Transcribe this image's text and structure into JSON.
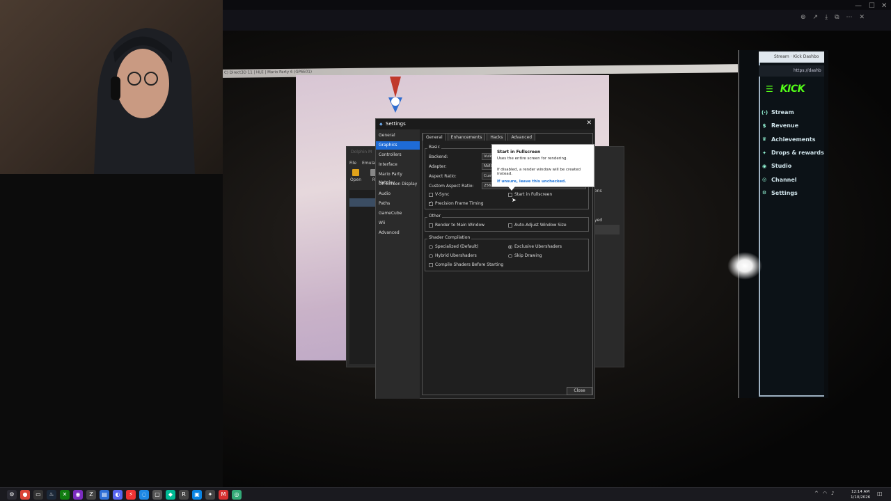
{
  "settings_window": {
    "title": "Settings",
    "sidebar": [
      "General",
      "Graphics",
      "Controllers",
      "Interface",
      "Mario Party Netplay",
      "On-Screen Display",
      "Audio",
      "Paths",
      "GameCube",
      "Wii",
      "Advanced"
    ],
    "active_sidebar": "Graphics",
    "tabs": [
      "General",
      "Enhancements",
      "Hacks",
      "Advanced"
    ],
    "active_tab": "General",
    "basic": {
      "group_label": "Basic",
      "backend_label": "Backend:",
      "backend_value": "Vulk",
      "adapter_label": "Adapter:",
      "adapter_value": "NVID",
      "aspect_label": "Aspect Ratio:",
      "aspect_value": "Cust",
      "custom_aspect_label": "Custom Aspect Ratio:",
      "custom_aspect_value": "2560",
      "vsync_label": "V-Sync",
      "start_fullscreen_label": "Start in Fullscreen",
      "precision_label": "Precision Frame Timing"
    },
    "other": {
      "group_label": "Other",
      "render_main_label": "Render to Main Window",
      "auto_adjust_label": "Auto-Adjust Window Size"
    },
    "shader": {
      "group_label": "Shader Compilation",
      "specialized": "Specialized (Default)",
      "exclusive": "Exclusive Ubershaders",
      "hybrid": "Hybrid Ubershaders",
      "skip": "Skip Drawing",
      "compile_before": "Compile Shaders Before Starting"
    },
    "close_button": "Close",
    "close_glyph": "✕",
    "checks": {
      "vsync": false,
      "start_fullscreen": false,
      "precision": true,
      "render_main": false,
      "auto_adjust": false,
      "compile_before": false
    },
    "radio_selected": "exclusive"
  },
  "tooltip": {
    "title": "Start in Fullscreen",
    "line1": "Uses the entire screen for rendering.",
    "line2": "If disabled, a render window will be created instead.",
    "hint": "If unsure, leave this unchecked."
  },
  "dolphin_main": {
    "title": "Dolphin M",
    "menu": [
      "File",
      "Emulati"
    ],
    "toolbar": [
      "Open",
      "R"
    ],
    "right_label": "ons",
    "right_label2": "yed",
    "col_label": "B"
  },
  "game_window": {
    "title": "C) Direct3D 11 | HLE | Mario Party 6 (GP6E01)"
  },
  "kick": {
    "tab_title": "Stream · Kick Dashbo",
    "url": "https://dashb",
    "logo": "KICK",
    "nav": [
      {
        "label": "Stream",
        "icon": "stream-icon"
      },
      {
        "label": "Revenue",
        "icon": "revenue-icon"
      },
      {
        "label": "Achievements",
        "icon": "trophy-icon"
      },
      {
        "label": "Drops & rewards",
        "icon": "gift-icon"
      },
      {
        "label": "Studio",
        "icon": "studio-icon"
      },
      {
        "label": "Channel",
        "icon": "channel-icon"
      },
      {
        "label": "Settings",
        "icon": "settings-icon"
      }
    ],
    "brand_color": "#53fc18"
  },
  "taskbar": {
    "time": "12:14 AM",
    "date": "1/10/2026"
  }
}
